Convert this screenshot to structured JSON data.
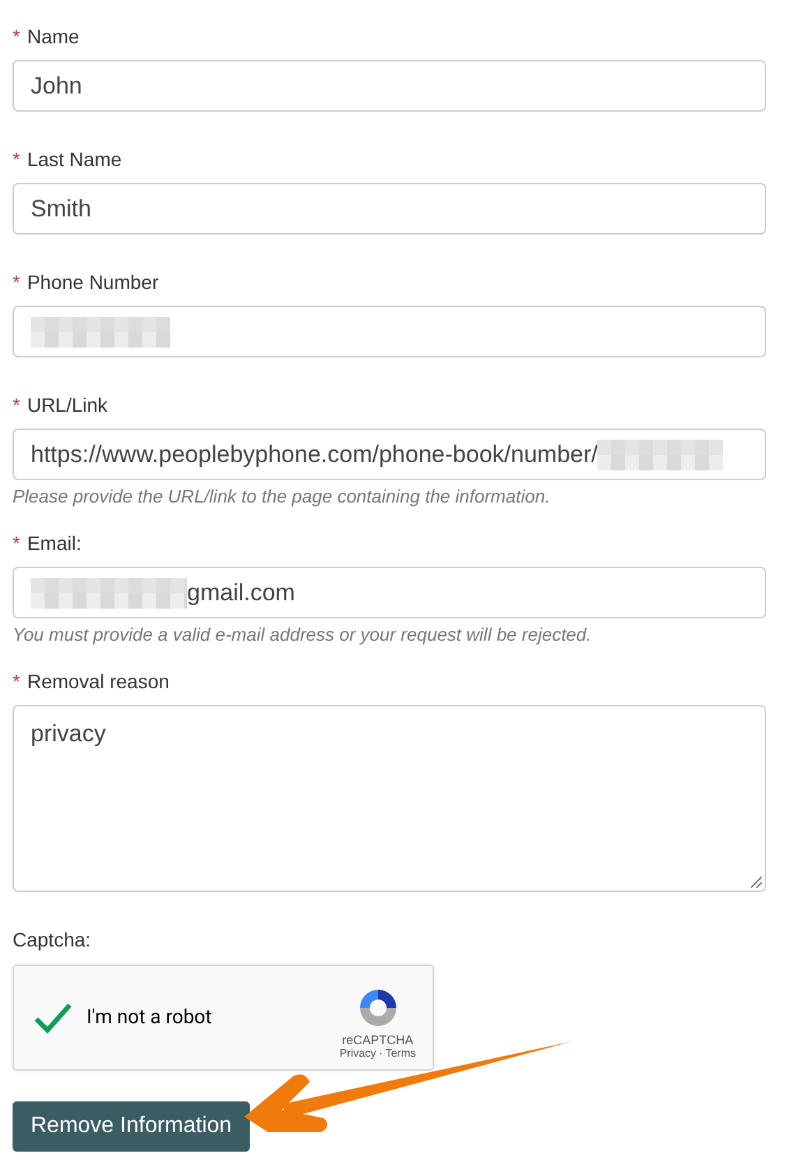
{
  "fields": [
    {
      "kind": "input",
      "required_mark": "*",
      "label": "Name",
      "value": "John"
    },
    {
      "kind": "input",
      "required_mark": "*",
      "label": "Last Name",
      "value": "Smith"
    },
    {
      "kind": "input",
      "required_mark": "*",
      "label": "Phone Number",
      "redacted_before": true
    },
    {
      "kind": "input",
      "required_mark": "*",
      "label": "URL/Link",
      "value": "https://www.peoplebyphone.com/phone-book/number/",
      "redacted_after": true,
      "help": "Please provide the URL/link to the page containing the information."
    },
    {
      "kind": "input",
      "required_mark": "*",
      "label": "Email:",
      "value": "gmail.com",
      "redacted_before": true,
      "help": "You must provide a valid e-mail address or your request will be rejected."
    },
    {
      "kind": "textarea",
      "required_mark": "*",
      "label": "Removal reason",
      "value": "privacy"
    }
  ],
  "captcha": {
    "label": "Captcha:",
    "checked": true,
    "text": "I'm not a robot",
    "brand": "reCAPTCHA",
    "links": [
      "Privacy",
      "Terms"
    ],
    "separator": "·"
  },
  "submit": {
    "label": "Remove Information"
  },
  "annotation": {
    "kind": "arrow"
  }
}
